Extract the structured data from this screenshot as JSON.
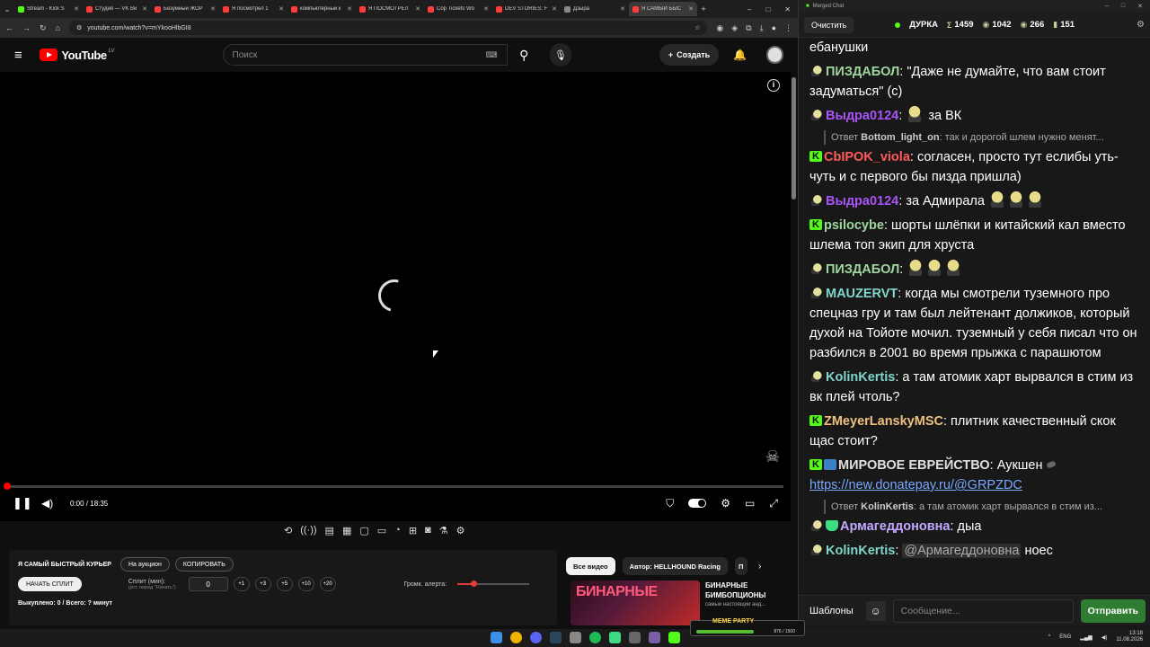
{
  "browser": {
    "tabs": [
      {
        "title": "Stream - Kick S",
        "color": "#53fc18",
        "active": false
      },
      {
        "title": "Студия — VK Ви",
        "color": "#ff3d3d",
        "active": false
      },
      {
        "title": "Безумный ЖОР",
        "color": "#ff3d3d",
        "active": false
      },
      {
        "title": "Я посмотрел 1",
        "color": "#ff3d3d",
        "active": false
      },
      {
        "title": "компьютерный к",
        "color": "#ff3d3d",
        "active": false
      },
      {
        "title": "Я ПОСМОТРЕЛ",
        "color": "#ff3d3d",
        "active": false
      },
      {
        "title": "Cop Tickets Wo",
        "color": "#ff3d3d",
        "active": false
      },
      {
        "title": "DEV STORIES: F",
        "color": "#ff3d3d",
        "active": false
      },
      {
        "title": "Дзыра",
        "color": "#888888",
        "active": false
      },
      {
        "title": "Я САМЫЙ БЫС",
        "color": "#ff3d3d",
        "active": true
      }
    ],
    "url": "youtube.com/watch?v=mYkooHlbGI8"
  },
  "youtube": {
    "logo_text": "YouTube",
    "country": "LV",
    "search_placeholder": "Поиск",
    "create_label": "Создать",
    "time": "0:00 / 18:35",
    "progress": 0
  },
  "panel": {
    "title": "Я САМЫЙ БЫСТРЫЙ КУРЬЕР",
    "auction_btn": "На аукцион",
    "copy_btn": "КОПИРОВАТЬ",
    "start_split_btn": "НАЧАТЬ СПЛИТ",
    "split_label": "Сплит (мин):",
    "split_sub": "(уст. перед \"Начать\")",
    "split_value": "0",
    "chips": [
      "+1",
      "+3",
      "+5",
      "+10",
      "+20"
    ],
    "volume_label": "Громк. алерта:",
    "volume_level": 0.22,
    "status": "Выкуплено: 0 / Всего: ? минут"
  },
  "recommendations": {
    "chips": [
      "Все видео",
      "Автор: HELLHOUND Racing",
      "П"
    ],
    "item": {
      "thumb_text": "БИНАРНЫЕ",
      "title": "БИНАРНЫЕ БИМБОПЦИОНЫ",
      "sub": "самый настоящий анд..."
    }
  },
  "chat": {
    "window_title": "Merged Chat",
    "clear_btn": "Очистить",
    "channel": "ДУРКА",
    "stats": [
      {
        "icon": "Σ",
        "value": "1459"
      },
      {
        "icon": "◉",
        "value": "1042"
      },
      {
        "icon": "◉",
        "value": "266"
      },
      {
        "icon": "▮",
        "value": "151"
      }
    ],
    "messages": [
      {
        "type": "text",
        "user": "",
        "color": "",
        "badge": "",
        "text": "ебанушки"
      },
      {
        "type": "msg",
        "user": "ПИЗДАБОЛ",
        "color": "#9fd69f",
        "badge": "yt",
        "text": "\"Даже не думайте, что вам стоит задуматься\" (с)"
      },
      {
        "type": "msg",
        "user": "Выдра0124",
        "color": "#a855f7",
        "badge": "yt",
        "emotes": 1,
        "text": "за ВК"
      },
      {
        "type": "reply",
        "prefix": "Ответ",
        "user": "Bottom_light_on",
        "text": "так и дорогой шлем нужно менят..."
      },
      {
        "type": "msg",
        "user": "CbIPOK_viola",
        "color": "#ff5a5a",
        "badge": "kick",
        "text": "согласен, просто тут еслибы уть-чуть и с первого бы пизда пришла)"
      },
      {
        "type": "msg",
        "user": "Выдра0124",
        "color": "#a855f7",
        "badge": "yt",
        "text": "за Адмирала",
        "emotes_after": 3
      },
      {
        "type": "msg",
        "user": "psilocybe",
        "color": "#9fd69f",
        "badge": "kick",
        "text": "шорты шлёпки и китайский кал вместо шлема топ экип для хруста"
      },
      {
        "type": "msg",
        "user": "ПИЗДАБОЛ",
        "color": "#9fd69f",
        "badge": "yt",
        "emotes": 3,
        "text": ""
      },
      {
        "type": "msg",
        "user": "MAUZERVT",
        "color": "#7fd6c8",
        "badge": "yt",
        "text": "когда мы смотрели туземного про спецназ гру и там был лейтенант должиков, который духой на Тойоте мочил. туземный у себя писал что он разбился в 2001 во время прыжка с парашютом"
      },
      {
        "type": "msg",
        "user": "KolinKertis",
        "color": "#7fd6c8",
        "badge": "yt",
        "text": "а там атомик харт вырвался в стим из вк плей чтоль?"
      },
      {
        "type": "msg",
        "user": "ZMeyerLanskyMSC",
        "color": "#f0c080",
        "badge": "kick",
        "text": "плитник качественный скок щас стоит?"
      },
      {
        "type": "msg",
        "user": "МИРОВОЕ ЕВРЕЙСТВО",
        "color": "#e0e0e0",
        "badge": "kick",
        "badge2": "blue",
        "text": "Аукшен",
        "link": "https://new.donatepay.ru/@GRPZDC"
      },
      {
        "type": "reply",
        "prefix": "Ответ",
        "user": "KolinKertis",
        "text": "а там атомик харт вырвался в стим из..."
      },
      {
        "type": "msg",
        "user": "Армагеддоновна",
        "color": "#c4a8ff",
        "badge": "yt",
        "badge2": "shield",
        "text": "дыа"
      },
      {
        "type": "msg",
        "user": "KolinKertis",
        "color": "#7fd6c8",
        "badge": "yt",
        "mention": "@Армагеддоновна",
        "text": "ноес"
      }
    ],
    "templates_btn": "Шаблоны",
    "input_placeholder": "Сообщение...",
    "send_btn": "Отправить"
  },
  "overlay": {
    "title": "MEME PARTY",
    "value": "876 / 1500"
  },
  "taskbar": {
    "lang": "ENG",
    "time": "13:18",
    "date": "11.08.2026"
  }
}
